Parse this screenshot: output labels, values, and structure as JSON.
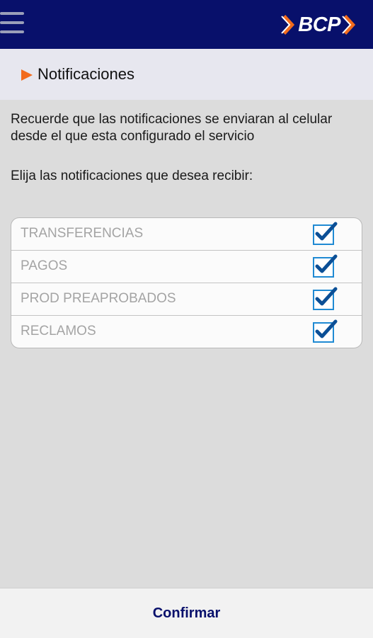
{
  "header": {
    "logo_text": "BCP",
    "menu_icon": "hamburger-menu-icon",
    "colors": {
      "background": "#08106b",
      "logo_accent": "#f26b1d"
    }
  },
  "section": {
    "title": "Notificaciones",
    "arrow_icon": "play-arrow-icon",
    "arrow_color": "#f26b1d"
  },
  "content": {
    "intro": "Recuerde que las notificaciones se enviaran al celular desde el que esta configurado el servicio",
    "prompt": "Elija las notificaciones que desea recibir:"
  },
  "options": [
    {
      "label": "TRANSFERENCIAS",
      "checked": true
    },
    {
      "label": "PAGOS",
      "checked": true
    },
    {
      "label": "PROD PREAPROBADOS",
      "checked": true
    },
    {
      "label": "RECLAMOS",
      "checked": true
    }
  ],
  "footer": {
    "confirm_label": "Confirmar",
    "confirm_color": "#08106b"
  }
}
